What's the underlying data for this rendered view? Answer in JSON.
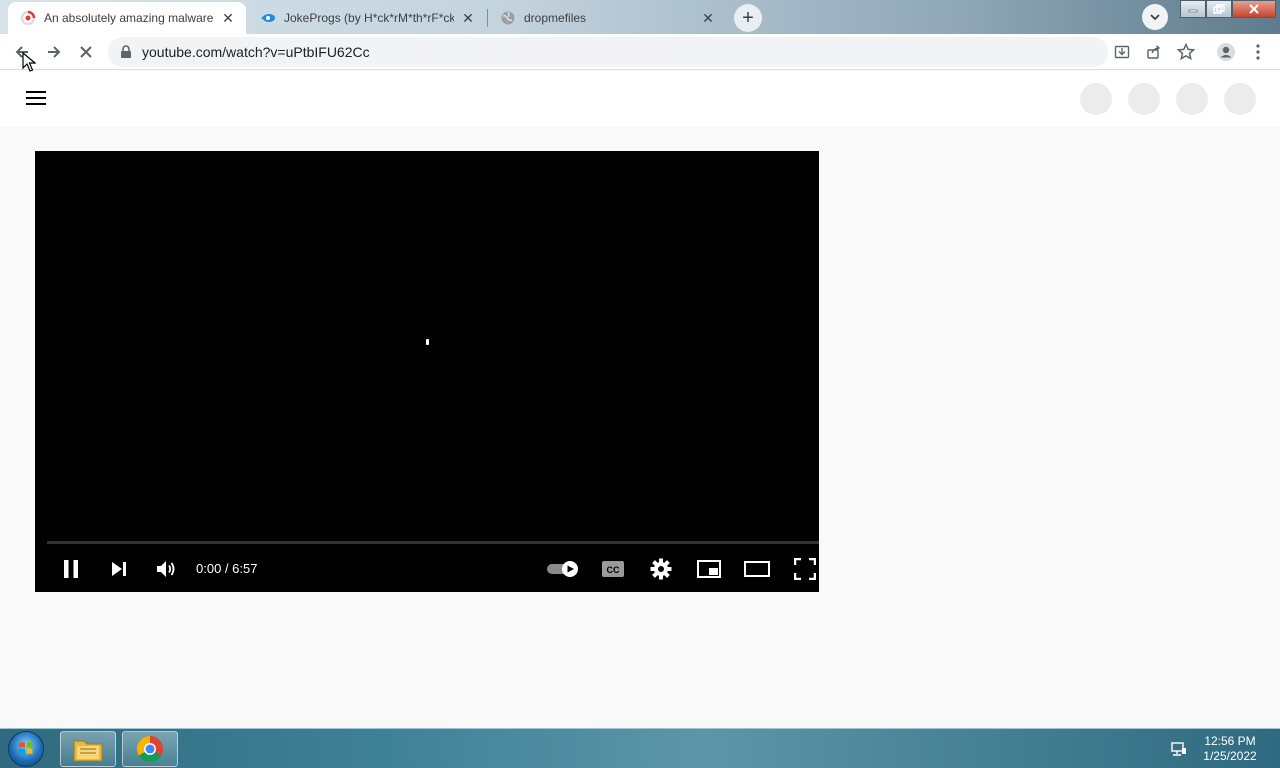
{
  "browser": {
    "tabs": [
      {
        "title": "An absolutely amazing malware",
        "active": true
      },
      {
        "title": "JokeProgs (by H*ck*rM*th*rF*ck*",
        "active": false
      },
      {
        "title": "dropmefiles",
        "active": false
      }
    ],
    "url": "youtube.com/watch?v=uPtbIFU62Cc"
  },
  "player": {
    "current_time": "0:00",
    "duration": "6:57",
    "time_display": "0:00 / 6:57",
    "progress_fraction": 0.0,
    "state": "playing"
  },
  "taskbar": {
    "time": "12:56 PM",
    "date": "1/25/2022"
  },
  "colors": {
    "accent_red": "#ff0000",
    "player_bg": "#000000",
    "page_bg": "#f9f9f9"
  },
  "icons": {
    "tab1_favicon": "youtube-loading-icon",
    "tab2_favicon": "jokeprogs-icon",
    "tab3_favicon": "globe-icon"
  }
}
